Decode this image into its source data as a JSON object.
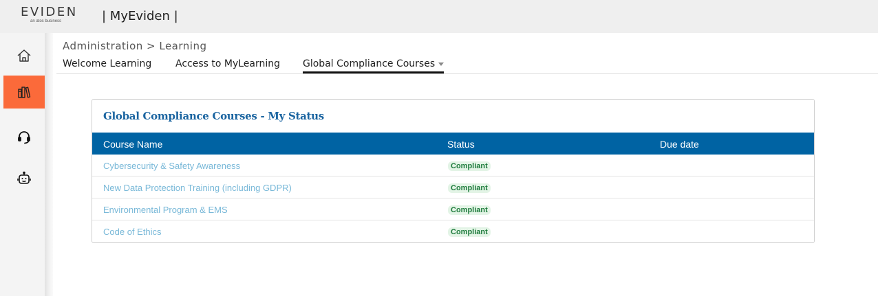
{
  "header": {
    "logo_text": "EVIDEN",
    "logo_subtext": "an atos business",
    "app_title": "| MyEviden |"
  },
  "sidebar": {
    "items": [
      {
        "icon": "home-icon",
        "active": false
      },
      {
        "icon": "books-icon",
        "active": true
      },
      {
        "icon": "headset-icon",
        "active": false
      },
      {
        "icon": "bot-icon",
        "active": false
      }
    ]
  },
  "breadcrumb": "Administration > Learning",
  "tabs": [
    {
      "label": "Welcome Learning",
      "active": false
    },
    {
      "label": "Access to MyLearning",
      "active": false
    },
    {
      "label": "Global Compliance Courses",
      "active": true,
      "has_dropdown": true
    }
  ],
  "status_card": {
    "title": "Global Compliance Courses - My Status",
    "columns": [
      "Course Name",
      "Status",
      "Due date"
    ],
    "rows": [
      {
        "course": "Cybersecurity & Safety Awareness",
        "status": "Compliant",
        "due": ""
      },
      {
        "course": "New Data Protection Training (including GDPR)",
        "status": "Compliant",
        "due": ""
      },
      {
        "course": "Environmental Program & EMS",
        "status": "Compliant",
        "due": ""
      },
      {
        "course": "Code of Ethics",
        "status": "Compliant",
        "due": ""
      }
    ]
  },
  "colors": {
    "accent_orange": "#fb6a3a",
    "header_blue": "#0063a3",
    "title_blue": "#1a64a0",
    "link_blue": "#78b8d8",
    "badge_green_bg": "#e3f4e6",
    "badge_green_text": "#1e7b3c"
  }
}
